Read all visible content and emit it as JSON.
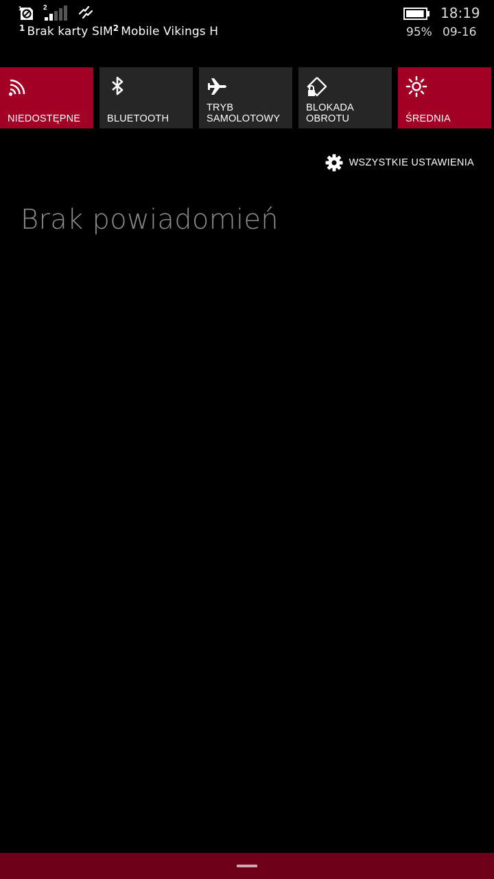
{
  "status_bar": {
    "sim_icon": "sim-card-blocked-icon",
    "signal_sim_number": "2",
    "signal_icon": "signal-bars-icon",
    "sync_icon": "data-sync-icon",
    "sim1_number": "1",
    "sim1_text": "Brak karty SIM",
    "sim2_number": "2",
    "sim2_text": "Mobile Vikings H",
    "battery_icon": "battery-icon",
    "battery_level": 0.95,
    "battery_percent": "95%",
    "time": "18:19",
    "date": "09-16"
  },
  "quick_actions": [
    {
      "label": "NIEDOSTĘPNE",
      "icon": "wifi-icon",
      "active": true
    },
    {
      "label": "BLUETOOTH",
      "icon": "bluetooth-icon",
      "active": false
    },
    {
      "label": "TRYB\nSAMOLOTOWY",
      "icon": "airplane-icon",
      "active": false
    },
    {
      "label": "BLOKADA\nOBROTU",
      "icon": "rotation-lock-icon",
      "active": false
    },
    {
      "label": "ŚREDNIA",
      "icon": "brightness-icon",
      "active": true
    }
  ],
  "all_settings": {
    "label": "WSZYSTKIE USTAWIENIA",
    "icon": "gear-icon"
  },
  "notifications": {
    "empty_message": "Brak powiadomień"
  },
  "colors": {
    "accent": "#a20025",
    "tile_inactive": "#262626",
    "bottom_bar": "#6e0019",
    "empty_text": "#8c8c8c"
  }
}
